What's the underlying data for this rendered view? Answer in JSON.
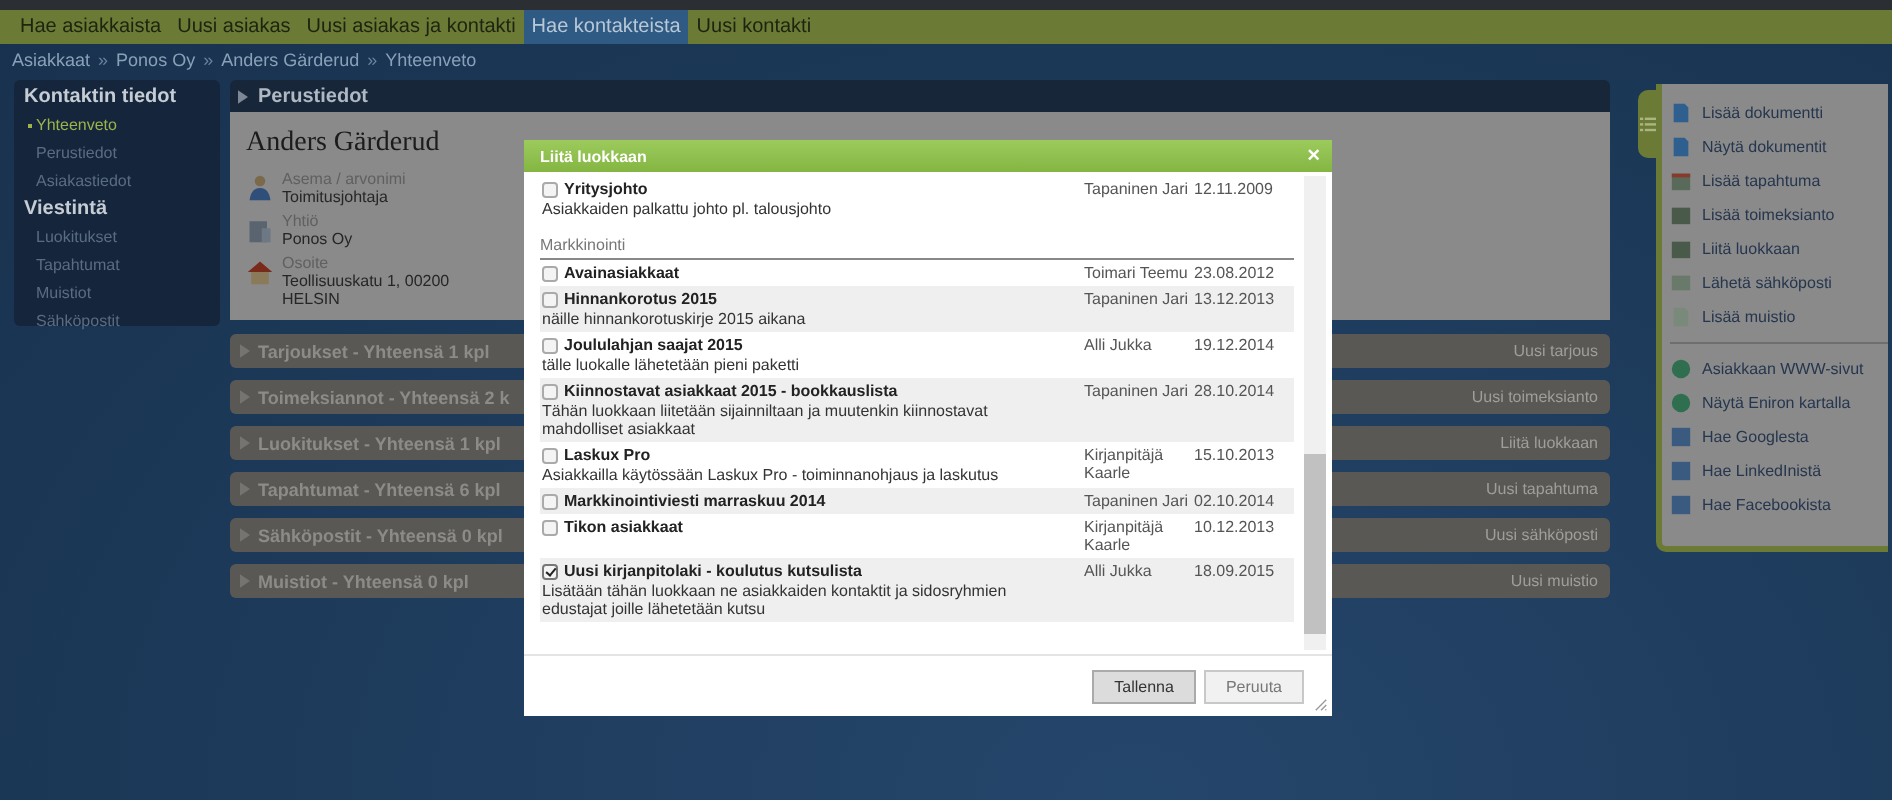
{
  "nav": {
    "tabs": [
      {
        "label": "Hae asiakkaista",
        "selected": false
      },
      {
        "label": "Uusi asiakas",
        "selected": false
      },
      {
        "label": "Uusi asiakas ja kontakti",
        "selected": false
      },
      {
        "label": "Hae kontakteista",
        "selected": true
      },
      {
        "label": "Uusi kontakti",
        "selected": false
      }
    ]
  },
  "breadcrumb": {
    "separator": "»",
    "items": [
      "Asiakkaat",
      "Ponos Oy",
      "Anders Gärderud",
      "Yhteenveto"
    ]
  },
  "sidebar": {
    "sections": [
      {
        "title": "Kontaktin tiedot",
        "items": [
          {
            "label": "Yhteenveto",
            "selected": true
          },
          {
            "label": "Perustiedot",
            "selected": false
          },
          {
            "label": "Asiakastiedot",
            "selected": false
          }
        ]
      },
      {
        "title": "Viestintä",
        "items": [
          {
            "label": "Luokitukset",
            "selected": false
          },
          {
            "label": "Tapahtumat",
            "selected": false
          },
          {
            "label": "Muistiot",
            "selected": false
          },
          {
            "label": "Sähköpostit",
            "selected": false
          }
        ]
      }
    ]
  },
  "basic_info": {
    "title": "Perustiedot",
    "name": "Anders Gärderud",
    "fields": [
      {
        "label": "Asema / arvonimi",
        "value": "Toimitusjohtaja"
      },
      {
        "label": "Yhtiö",
        "value": "Ponos Oy"
      },
      {
        "label": "Osoite",
        "value": "Teollisuuskatu 1, 00200 HELSIN"
      }
    ]
  },
  "sections": [
    {
      "title": "Tarjoukset - Yhteensä 1 kpl",
      "action": "Uusi tarjous"
    },
    {
      "title": "Toimeksiannot - Yhteensä 2 k",
      "action": "Uusi toimeksianto"
    },
    {
      "title": "Luokitukset - Yhteensä 1 kpl",
      "action": "Liitä luokkaan"
    },
    {
      "title": "Tapahtumat - Yhteensä 6 kpl",
      "action": "Uusi tapahtuma"
    },
    {
      "title": "Sähköpostit - Yhteensä 0 kpl",
      "action": "Uusi sähköposti"
    },
    {
      "title": "Muistiot - Yhteensä 0 kpl",
      "action": "Uusi muistio"
    }
  ],
  "actions_panel": {
    "groups": [
      {
        "items": [
          "Lisää dokumentti",
          "Näytä dokumentit",
          "Lisää tapahtuma",
          "Lisää toimeksianto",
          "Liitä luokkaan",
          "Lähetä sähköposti",
          "Lisää muistio"
        ]
      },
      {
        "items": [
          "Asiakkaan WWW-sivut",
          "Näytä Eniron kartalla",
          "Hae Googlesta",
          "Hae LinkedInistä",
          "Hae Facebookista"
        ]
      }
    ]
  },
  "dialog": {
    "title": "Liitä luokkaan",
    "close": "×",
    "groups": [
      {
        "items": [
          {
            "name": "Yritysjohto",
            "description": "Asiakkaiden palkattu johto pl. talousjohto",
            "owner": "Tapaninen Jari",
            "date": "12.11.2009",
            "checked": false
          }
        ]
      },
      {
        "heading": "Markkinointi",
        "items": [
          {
            "name": "Avainasiakkaat",
            "owner": "Toimari Teemu",
            "date": "23.08.2012",
            "checked": false
          },
          {
            "name": "Hinnankorotus 2015",
            "description": "näille hinnankorotuskirje 2015 aikana",
            "owner": "Tapaninen Jari",
            "date": "13.12.2013",
            "checked": false
          },
          {
            "name": "Joululahjan saajat 2015",
            "description": "tälle luokalle lähetetään pieni paketti",
            "owner": "Alli Jukka",
            "date": "19.12.2014",
            "checked": false
          },
          {
            "name": "Kiinnostavat asiakkaat 2015 - bookkauslista",
            "description": "Tähän luokkaan liitetään sijainniltaan ja muutenkin kiinnostavat mahdolliset asiakkaat",
            "owner": "Tapaninen Jari",
            "date": "28.10.2014",
            "checked": false
          },
          {
            "name": "Laskux Pro",
            "description": "Asiakkailla käytössään Laskux Pro - toiminnanohjaus ja laskutus",
            "owner": "Kirjanpitäjä Kaarle",
            "date": "15.10.2013",
            "checked": false
          },
          {
            "name": "Markkinointiviesti marraskuu 2014",
            "owner": "Tapaninen Jari",
            "date": "02.10.2014",
            "checked": false
          },
          {
            "name": "Tikon asiakkaat",
            "owner": "Kirjanpitäjä Kaarle",
            "date": "10.12.2013",
            "checked": false
          },
          {
            "name": "Uusi kirjanpitolaki - koulutus kutsulista",
            "description": "Lisätään tähän luokkaan ne asiakkaiden kontaktit ja sidosryhmien edustajat joille lähetetään kutsu",
            "owner": "Alli Jukka",
            "date": "18.09.2015",
            "checked": true
          }
        ]
      }
    ],
    "buttons": [
      "Tallenna",
      "Peruuta"
    ]
  }
}
